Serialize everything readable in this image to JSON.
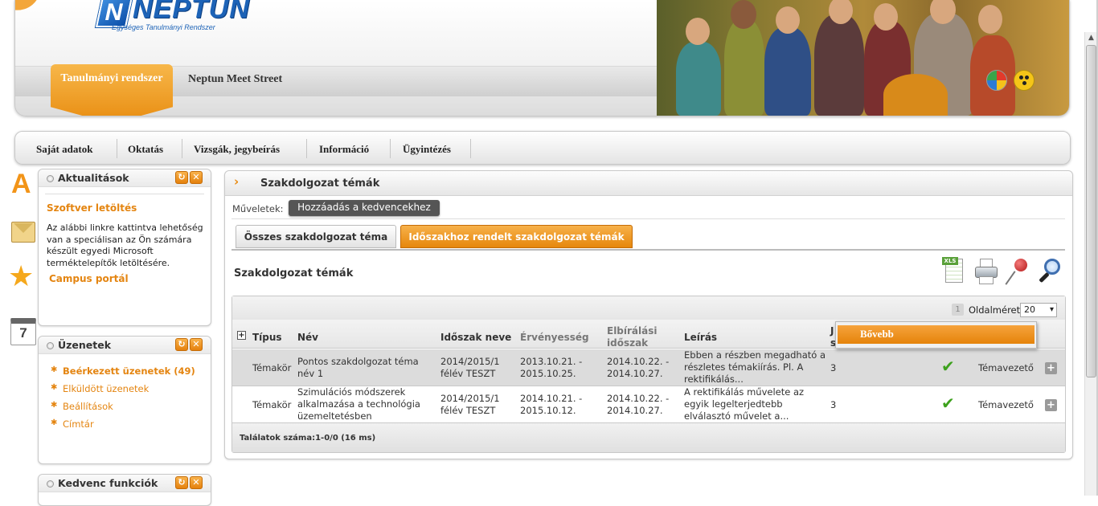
{
  "header": {
    "logo_letter": "N",
    "logo_text": "NEPTUN",
    "logo_sub": "Egységes Tanulmányi Rendszer",
    "tabs": [
      {
        "label": "Tanulmányi rendszer",
        "active": true
      },
      {
        "label": "Neptun Meet Street",
        "active": false
      }
    ]
  },
  "main_menu": [
    "Saját adatok",
    "Oktatás",
    "Vizsgák, jegybeírás",
    "Információ",
    "Ügyintézés"
  ],
  "side_icons": {
    "letter": "A",
    "calendar_day": "7"
  },
  "news_box": {
    "title": "Aktualitások",
    "link_title": "Szoftver letöltés",
    "text": "Az alábbi linkre kattintva lehetőség van a speciálisan az Ön számára készült egyedi Microsoft terméktelepítők letöltésére.",
    "link": "Campus portál"
  },
  "messages_box": {
    "title": "Üzenetek",
    "items": [
      "Beérkezett üzenetek (49)",
      "Elküldött üzenetek",
      "Beállítások",
      "Címtár"
    ]
  },
  "favorites_box": {
    "title": "Kedvenc funkciók"
  },
  "page": {
    "title": "Szakdolgozat témák",
    "operations_label": "Műveletek:",
    "favorite_button": "Hozzáadás a kedvencekhez",
    "tabs": [
      {
        "label": "Összes szakdolgozat téma",
        "active": false
      },
      {
        "label": "Időszakhoz rendelt szakdolgozat témák",
        "active": true
      }
    ],
    "section_title": "Szakdolgozat témák",
    "xls_tag": "XLS"
  },
  "grid": {
    "page_number": "1",
    "page_size_label": "Oldalméret",
    "page_size": "20",
    "expand_symbol": "+",
    "columns": {
      "type": "Típus",
      "name": "Név",
      "period": "Időszak neve",
      "validity": "Érvényesség",
      "eval_l1": "Elbírálási",
      "eval_l2": "időszak",
      "desc": "Leírás",
      "j_l1": "J",
      "j_l2": "s"
    },
    "rows": [
      {
        "type": "Témakör",
        "name_l1": "Pontos szakdolgozat téma",
        "name_l2": "név 1",
        "period_l1": "2014/2015/1",
        "period_l2": "félév TESZT",
        "validity_l1": "2013.10.21. -",
        "validity_l2": "2015.10.25.",
        "eval_l1": "2014.10.22. -",
        "eval_l2": "2014.10.27.",
        "desc_l1": "Ebben a részben megadható a",
        "desc_l2": "részletes témakiírás. Pl. A",
        "desc_l3": "rektifikálás...",
        "count": "3",
        "check": "✔",
        "role": "Témavezető",
        "plus": "+"
      },
      {
        "type": "Témakör",
        "name_l1": "Szimulációs módszerek",
        "name_l2": "alkalmazása a technológia",
        "name_l3": "üzemeltetésben",
        "period_l1": "2014/2015/1",
        "period_l2": "félév TESZT",
        "validity_l1": "2014.10.21. -",
        "validity_l2": "2015.10.12.",
        "eval_l1": "2014.10.22. -",
        "eval_l2": "2014.10.27.",
        "desc_l1": "A rektifikálás művelete az",
        "desc_l2": "egyik legelterjedtebb",
        "desc_l3": "elválasztó művelet a...",
        "count": "3",
        "check": "✔",
        "role": "Témavezető",
        "plus": "+"
      }
    ],
    "results": "Találatok száma:1-0/0 (16 ms)"
  },
  "context_menu": {
    "item": "Bővebb"
  },
  "colors": {
    "accent": "#e8890f",
    "check": "#3da11d",
    "brand": "#1d63b7"
  }
}
